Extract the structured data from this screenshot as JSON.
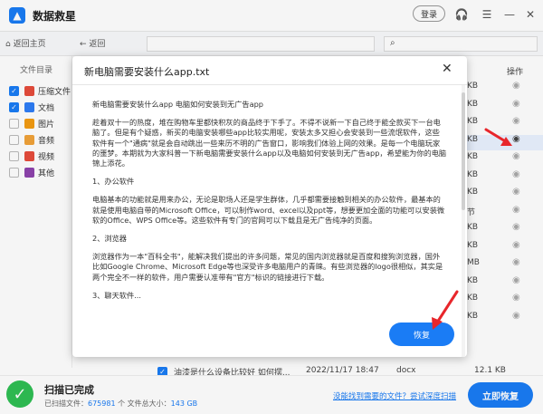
{
  "app": {
    "title": "数据救星",
    "login_label": "登录"
  },
  "nav": {
    "home_label": "返回主页",
    "back_label": "返回"
  },
  "sidebar": {
    "header": "文件目录",
    "items": [
      {
        "label": "压缩文件",
        "checked": true,
        "color": "#e74c3c"
      },
      {
        "label": "文档",
        "checked": true,
        "color": "#2e7df6"
      },
      {
        "label": "图片",
        "checked": false,
        "color": "#f39c12"
      },
      {
        "label": "音频",
        "checked": false,
        "color": "#f1a33a"
      },
      {
        "label": "视频",
        "checked": false,
        "color": "#e74c3c"
      },
      {
        "label": "其他",
        "checked": false,
        "color": "#8e44ad"
      }
    ]
  },
  "table": {
    "action_header": "操作",
    "sizes": [
      "KB",
      "KB",
      "KB",
      "KB",
      "KB",
      "KB",
      "KB",
      "节",
      "KB",
      "KB",
      "MB",
      "KB",
      "KB",
      "KB"
    ],
    "bottom_row": {
      "name": "油漆是什么设备比较好 如何摆...",
      "date": "2022/11/17 18:47",
      "type": "docx",
      "size": "12.1 KB"
    }
  },
  "dialog": {
    "title": "新电脑需要安装什么app.txt",
    "paragraphs": [
      "新电脑需要安装什么app 电脑如何安装到无广告app",
      "趁着双十一的热度，堆在购物车里都快积灰的商品终于下手了。不得不说新一下自己终于能全款买下一台电脑了。但是有个疑惑，新买的电脑安装哪些app比较实用呢，安装太多又担心会安装到一些流氓软件，这些软件有一个\"通病\"就是会自动跳出一些来历不明的广告窗口，影响我们体验上网的效果。是每一个电脑玩家的噩梦。本期就为大家科普一下新电脑需要安装什么app以及电脑如何安装到无广告app，希望能为你的电脑锦上添花。",
      "1、办公软件",
      "电脑基本的功能就是用来办公，无论是职场人还是学生群体，几乎都需要接触到相关的办公软件，最基本的就是使用电脑自带的Microsoft Office，可以制作word、excel以及ppt等，想要更加全面的功能可以安装微软的Office、WPS Office等。这些软件有专门的官网可以下载且是无广告纯净的页面。",
      "2、浏览器",
      "浏览器作为一本\"百科全书\"，能解决我们提出的许多问题，常见的国内浏览器就是百度和搜狗浏览器，国外比如Google Chrome、Microsoft Edge等也深受许多电脑用户的青睐。有些浏览器的logo很相似，其实是两个完全不一样的软件，用户需要认准带有\"官方\"标识的链接进行下载。",
      "3、聊天软件..."
    ],
    "recover_label": "恢复"
  },
  "status": {
    "title": "扫描已完成",
    "scanned_label": "已扫描文件：",
    "scanned_count": "675981",
    "size_label": "个 文件总大小：",
    "total_size": "143 GB",
    "deep_scan_link": "没能找到需要的文件？尝试深度扫描",
    "recover_now_label": "立即恢复"
  }
}
